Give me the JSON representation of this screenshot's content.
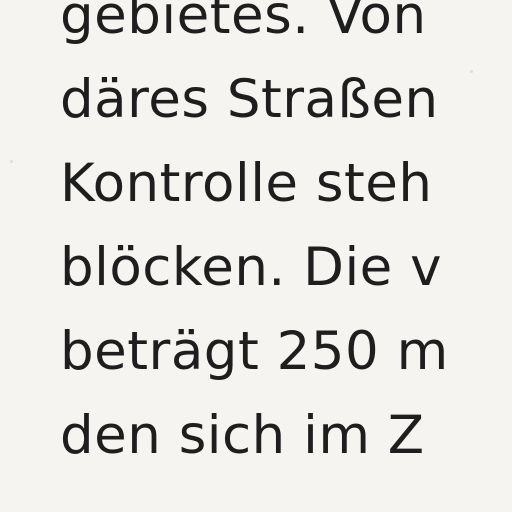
{
  "document": {
    "lines": [
      "gebietes. Von",
      "däres Straßen",
      "Kontrolle  steh",
      "blöcken. Die v",
      "beträgt 250 m",
      "den  sich  im  Z"
    ]
  }
}
